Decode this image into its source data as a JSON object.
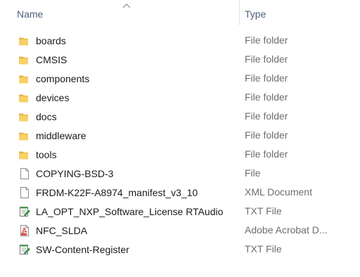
{
  "columns": {
    "name_label": "Name",
    "type_label": "Type",
    "sort_direction": "ascending"
  },
  "colors": {
    "folder": "#e8b84a",
    "header_text": "#4c607a",
    "type_text": "#6d6d6d",
    "pdf_red": "#d8302a",
    "txt_green": "#3aa34a"
  },
  "items": [
    {
      "name": "boards",
      "type": "File folder",
      "icon": "folder-icon"
    },
    {
      "name": "CMSIS",
      "type": "File folder",
      "icon": "folder-icon"
    },
    {
      "name": "components",
      "type": "File folder",
      "icon": "folder-icon"
    },
    {
      "name": "devices",
      "type": "File folder",
      "icon": "folder-icon"
    },
    {
      "name": "docs",
      "type": "File folder",
      "icon": "folder-icon"
    },
    {
      "name": "middleware",
      "type": "File folder",
      "icon": "folder-icon"
    },
    {
      "name": "tools",
      "type": "File folder",
      "icon": "folder-icon"
    },
    {
      "name": "COPYING-BSD-3",
      "type": "File",
      "icon": "file-icon"
    },
    {
      "name": "FRDM-K22F-A8974_manifest_v3_10",
      "type": "XML Document",
      "icon": "xml-file-icon"
    },
    {
      "name": "LA_OPT_NXP_Software_License RTAudio",
      "type": "TXT File",
      "icon": "text-file-icon"
    },
    {
      "name": "NFC_SLDA",
      "type": "Adobe Acrobat D...",
      "icon": "pdf-file-icon"
    },
    {
      "name": "SW-Content-Register",
      "type": "TXT File",
      "icon": "text-file-icon"
    }
  ]
}
